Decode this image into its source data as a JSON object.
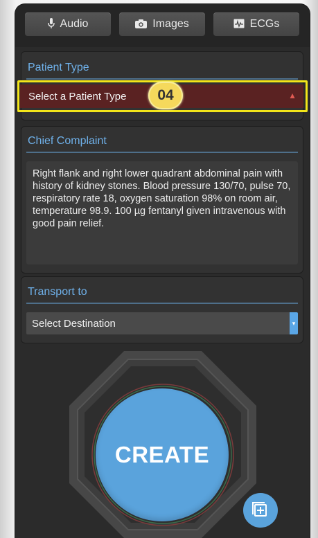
{
  "toolbar": {
    "audio_label": "Audio",
    "audio_icon": "microphone-icon",
    "images_label": "Images",
    "images_icon": "camera-icon",
    "ecgs_label": "ECGs",
    "ecgs_icon": "ecg-icon"
  },
  "patient_type": {
    "title": "Patient Type",
    "select_value": "Select a Patient Type",
    "warning_icon": "warning-icon",
    "step_badge": "04",
    "error_color": "#5a2222",
    "highlight_color": "#f3e61a"
  },
  "chief_complaint": {
    "title": "Chief Complaint",
    "text": "Right flank and right lower quadrant abdominal pain with history of kidney stones. Blood pressure 130/70, pulse 70, respiratory rate 18, oxygen saturation 98% on room air, temperature 98.9. 100 µg fentanyl given intravenous with good pain relief."
  },
  "transport": {
    "title": "Transport to",
    "select_value": "Select Destination",
    "chevron_icon": "dropdown-chevron-icon"
  },
  "actions": {
    "create_label": "CREATE",
    "fab_icon": "add-copy-icon",
    "accent_color": "#5aa3dc"
  }
}
